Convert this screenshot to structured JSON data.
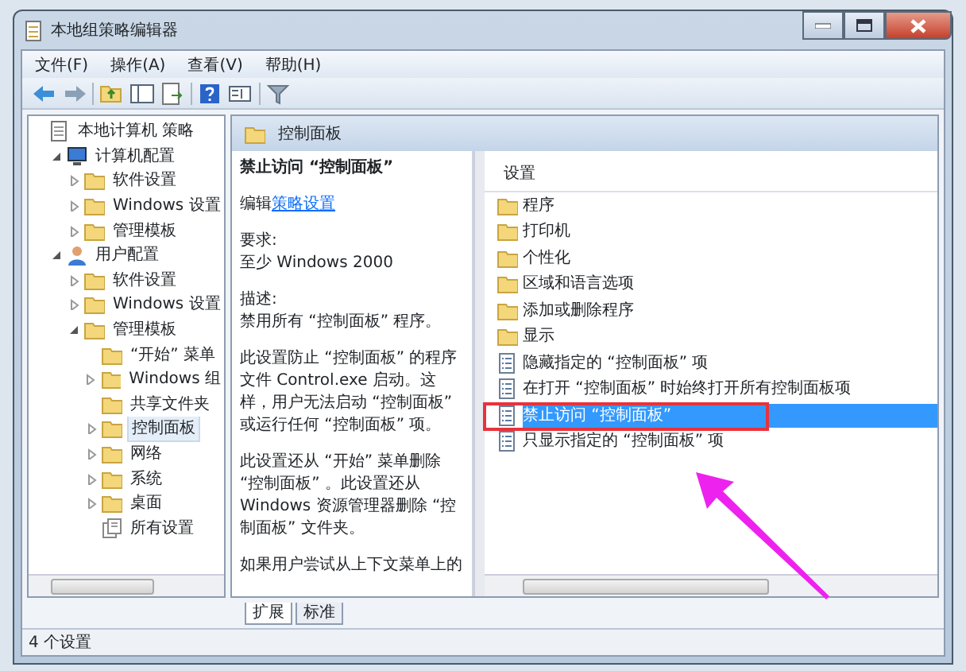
{
  "window": {
    "title": "本地组策略编辑器"
  },
  "menu": [
    "文件(F)",
    "操作(A)",
    "查看(V)",
    "帮助(H)"
  ],
  "tree": [
    {
      "label": "本地计算机 策略",
      "kind": "policy",
      "selected": false,
      "children": [
        {
          "label": "计算机配置",
          "kind": "computer",
          "expanded": true,
          "selected": false,
          "children": [
            {
              "label": "软件设置",
              "kind": "folder",
              "expanded": false,
              "selected": false
            },
            {
              "label": "Windows 设置",
              "kind": "folder",
              "expanded": false,
              "selected": false
            },
            {
              "label": "管理模板",
              "kind": "folder",
              "expanded": false,
              "selected": false
            }
          ]
        },
        {
          "label": "用户配置",
          "kind": "user",
          "expanded": true,
          "selected": false,
          "children": [
            {
              "label": "软件设置",
              "kind": "folder",
              "expanded": false,
              "selected": false
            },
            {
              "label": "Windows 设置",
              "kind": "folder",
              "expanded": false,
              "selected": false
            },
            {
              "label": "管理模板",
              "kind": "folder",
              "expanded": true,
              "selected": false,
              "children": [
                {
                  "label": "“开始” 菜单",
                  "kind": "folder",
                  "selected": false
                },
                {
                  "label": "Windows 组",
                  "kind": "folder",
                  "expanded": false,
                  "selected": false
                },
                {
                  "label": "共享文件夹",
                  "kind": "folder",
                  "selected": false
                },
                {
                  "label": "控制面板",
                  "kind": "folder",
                  "expanded": false,
                  "selected": true
                },
                {
                  "label": "网络",
                  "kind": "folder",
                  "expanded": false,
                  "selected": false
                },
                {
                  "label": "系统",
                  "kind": "folder",
                  "expanded": false,
                  "selected": false
                },
                {
                  "label": "桌面",
                  "kind": "folder",
                  "expanded": false,
                  "selected": false
                },
                {
                  "label": "所有设置",
                  "kind": "all",
                  "selected": false
                }
              ]
            }
          ]
        }
      ]
    }
  ],
  "pane_header": "控制面板",
  "description": {
    "title": "禁止访问 “控制面板”",
    "edit_prefix": "编辑",
    "edit_link": "策略设置",
    "paragraphs": [
      "要求:\n至少 Windows 2000",
      "描述:\n禁用所有 “控制面板” 程序。",
      "此设置防止 “控制面板” 的程序文件 Control.exe 启动。这样，用户无法启动 “控制面板” 或运行任何 “控制面板” 项。",
      "此设置还从 “开始” 菜单删除 “控制面板” 。此设置还从 Windows 资源管理器删除 “控制面板” 文件夹。",
      "如果用户尝试从上下文菜单上的"
    ]
  },
  "list": {
    "column": "设置",
    "items": [
      {
        "label": "程序",
        "kind": "folder",
        "selected": false
      },
      {
        "label": "打印机",
        "kind": "folder",
        "selected": false
      },
      {
        "label": "个性化",
        "kind": "folder",
        "selected": false
      },
      {
        "label": "区域和语言选项",
        "kind": "folder",
        "selected": false
      },
      {
        "label": "添加或删除程序",
        "kind": "folder",
        "selected": false
      },
      {
        "label": "显示",
        "kind": "folder",
        "selected": false
      },
      {
        "label": "隐藏指定的 “控制面板” 项",
        "kind": "setting",
        "selected": false
      },
      {
        "label": "在打开 “控制面板” 时始终打开所有控制面板项",
        "kind": "setting",
        "selected": false
      },
      {
        "label": "禁止访问 “控制面板”",
        "kind": "setting",
        "selected": true
      },
      {
        "label": "只显示指定的 “控制面板” 项",
        "kind": "setting",
        "selected": false
      }
    ]
  },
  "view_tabs": [
    {
      "label": "扩展",
      "selected": true
    },
    {
      "label": "标准",
      "selected": false
    }
  ],
  "annotations": [
    {
      "kind": "box",
      "color": "#e8323c"
    },
    {
      "kind": "arrow",
      "color": "#ee22ee"
    }
  ],
  "status_bar": "4 个设置"
}
